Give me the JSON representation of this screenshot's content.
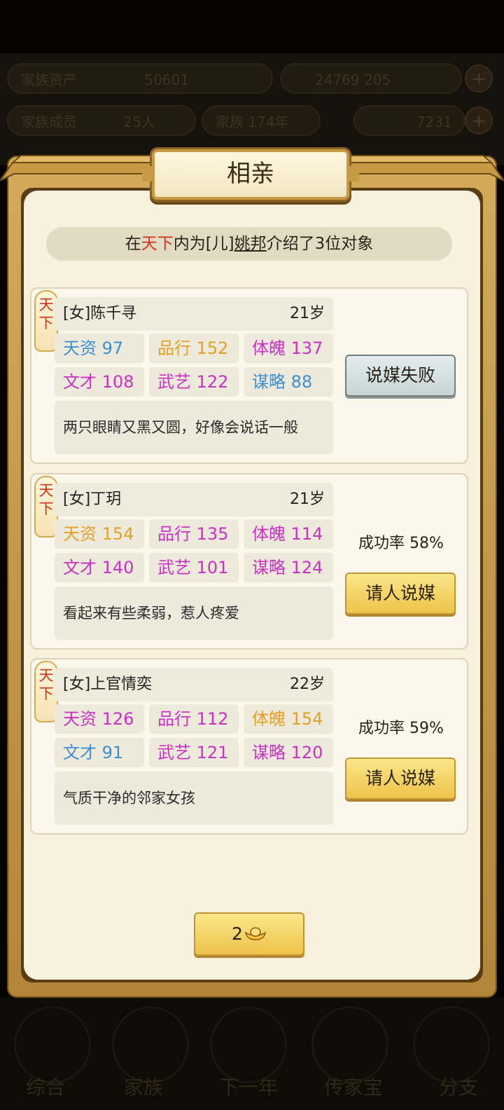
{
  "hud": {
    "row1_left": "家族资产",
    "row1_mid": "50601",
    "row1_right": "24769 205",
    "row2_left": "家族成员",
    "row2_mid": "25人",
    "row2_year": "家族 174年",
    "row2_right": "7231"
  },
  "dialog": {
    "title": "相亲",
    "intro": {
      "prefix": "在",
      "realm": "天下",
      "middle": "内为[儿]",
      "son": "姚邦",
      "suffix": "介绍了3位对象"
    }
  },
  "candidates": [
    {
      "realm_line1": "天",
      "realm_line2": "下",
      "name": "[女]陈千寻",
      "age": "21岁",
      "stats": [
        "天资 97",
        "品行 152",
        "体魄 137",
        "文才 108",
        "武艺 122",
        "谋略 88"
      ],
      "desc": "两只眼睛又黑又圆，好像会说话一般",
      "rate": "",
      "button": "说媒失败"
    },
    {
      "realm_line1": "天",
      "realm_line2": "下",
      "name": "[女]丁玥",
      "age": "21岁",
      "stats": [
        "天资 154",
        "品行 135",
        "体魄 114",
        "文才 140",
        "武艺 101",
        "谋略 124"
      ],
      "desc": "看起来有些柔弱，惹人疼爱",
      "rate": "成功率 58%",
      "button": "请人说媒"
    },
    {
      "realm_line1": "天",
      "realm_line2": "下",
      "name": "[女]上官情奕",
      "age": "22岁",
      "stats": [
        "天资 126",
        "品行 112",
        "体魄 154",
        "文才 91",
        "武艺 121",
        "谋略 120"
      ],
      "desc": "气质干净的邻家女孩",
      "rate": "成功率 59%",
      "button": "请人说媒"
    }
  ],
  "refresh": {
    "cost": "2",
    "icon": "gold-ingot-icon"
  },
  "nav": [
    "综合",
    "家族",
    "下一年",
    "传家宝",
    "分支"
  ],
  "colors": {
    "realm_red": "#d2321e",
    "stat_blue": "#3d8fd3",
    "stat_orange": "#e3a026",
    "stat_magenta": "#cc2fc4",
    "gold_button": "#eec34a",
    "fail_button": "#c8d5d5"
  }
}
